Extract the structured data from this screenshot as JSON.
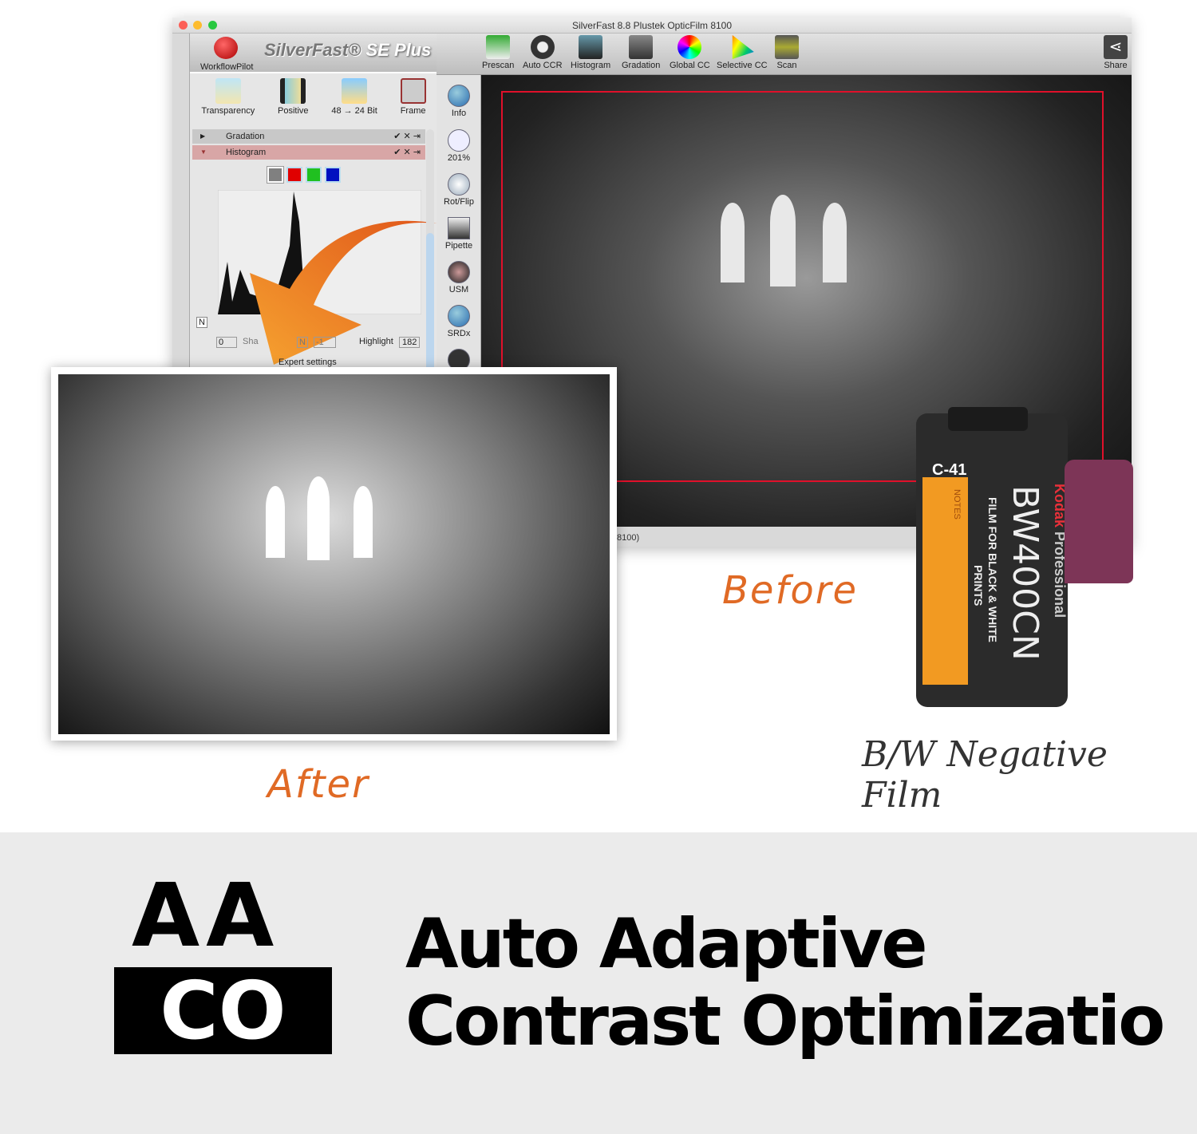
{
  "window": {
    "title": "SilverFast 8.8 Plustek OpticFilm 8100",
    "brand_name": "SilverFast",
    "brand_edition": "SE Plus",
    "workflow_pilot_label": "WorkflowPilot",
    "status_text": "8100)"
  },
  "left_panel": {
    "tools": [
      {
        "label": "Transparency",
        "icon": "transparency-icon"
      },
      {
        "label": "Positive",
        "icon": "film-positive-icon"
      },
      {
        "label": "48 → 24 Bit",
        "icon": "bit-depth-icon"
      },
      {
        "label": "Frame",
        "icon": "frame-tools-icon"
      }
    ],
    "sections": [
      {
        "label": "Gradation",
        "expanded": false
      },
      {
        "label": "Histogram",
        "expanded": true
      }
    ],
    "histogram": {
      "channels": [
        "#808080",
        "#e00000",
        "#20c020",
        "#0010c0"
      ],
      "n_button": "N",
      "shadow_value": "0",
      "shadow_label": "Sha",
      "mid_value": "-1",
      "highlight_label": "Highlight",
      "highlight_value": "182",
      "expert_settings": "Expert settings"
    }
  },
  "toolbar": {
    "items": [
      "Prescan",
      "Auto CCR",
      "Histogram",
      "Gradation",
      "Global CC",
      "Selective CC",
      "Scan"
    ],
    "share_label": "Share"
  },
  "side_tools": [
    "Info",
    "201%",
    "Rot/Flip",
    "Pipette",
    "USM",
    "SRDx"
  ],
  "captions": {
    "before": "Before",
    "after": "After",
    "film_label": "B/W Negative Film"
  },
  "film": {
    "process": "C-41",
    "notes": "NOTES",
    "brand": "Kodak",
    "line": "Professional",
    "name": "BW400CN",
    "desc1": "FILM FOR BLACK & WHITE",
    "desc2": "PRINTS"
  },
  "feature": {
    "logo_top": "AA",
    "logo_bottom": "CO",
    "line1": "Auto Adaptive",
    "line2": "Contrast Optimizatio"
  },
  "colors": {
    "accent_orange": "#e06a25",
    "crop_frame": "#e0102a"
  }
}
